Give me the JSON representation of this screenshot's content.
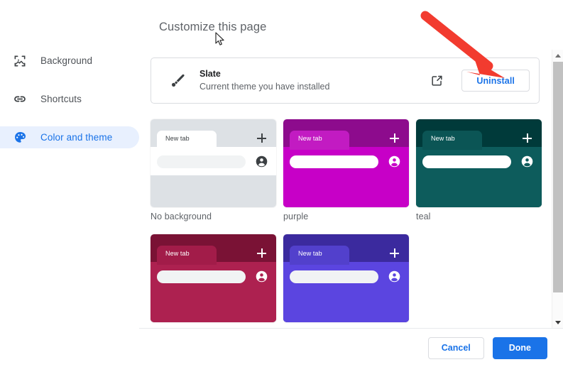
{
  "window": {
    "page_title": "Customize this page"
  },
  "sidebar": {
    "items": [
      {
        "label": "Background",
        "icon": "image-background-icon",
        "selected": false
      },
      {
        "label": "Shortcuts",
        "icon": "link-chain-icon",
        "selected": false
      },
      {
        "label": "Color and theme",
        "icon": "palette-icon",
        "selected": true
      }
    ]
  },
  "current_theme": {
    "icon": "paintbrush-icon",
    "name": "Slate",
    "description": "Current theme you have installed",
    "open_link_icon": "external-link-icon",
    "uninstall_label": "Uninstall"
  },
  "themes": {
    "rows": [
      [
        {
          "label": "No background",
          "frame_color": "#dde1e5",
          "body_color": "#ffffff",
          "lower_color": "#dde1e5",
          "tab_color": "#ffffff",
          "tab_text_color": "#3c4043",
          "plus_color": "#3c4043",
          "omnibox_color": "#f1f3f4",
          "avatar_color": "#3c4043",
          "tab_label": "New tab"
        },
        {
          "label": "purple",
          "frame_color": "#8d0b8d",
          "body_color": "#c700c7",
          "lower_color": "#c700c7",
          "tab_color": "#c21bc2",
          "tab_text_color": "#ffffff",
          "plus_color": "#ffffff",
          "omnibox_color": "#ffffff",
          "avatar_color": "#ffffff",
          "tab_label": "New tab"
        },
        {
          "label": "teal",
          "frame_color": "#003a3a",
          "body_color": "#0d5c5c",
          "lower_color": "#0d5c5c",
          "tab_color": "#0b5555",
          "tab_text_color": "#ffffff",
          "plus_color": "#ffffff",
          "omnibox_color": "#ffffff",
          "avatar_color": "#ffffff",
          "tab_label": "New tab"
        }
      ],
      [
        {
          "label": "",
          "frame_color": "#7a1235",
          "body_color": "#ad2150",
          "lower_color": "#ad2150",
          "tab_color": "#a21c49",
          "tab_text_color": "#ffffff",
          "plus_color": "#ffffff",
          "omnibox_color": "#f1f3f4",
          "avatar_color": "#ffffff",
          "tab_label": "New tab"
        },
        {
          "label": "",
          "frame_color": "#3b2a9e",
          "body_color": "#5b45e0",
          "lower_color": "#5b45e0",
          "tab_color": "#5240cc",
          "tab_text_color": "#ffffff",
          "plus_color": "#ffffff",
          "omnibox_color": "#f1f3f4",
          "avatar_color": "#ffffff",
          "tab_label": "New tab"
        }
      ]
    ]
  },
  "footer": {
    "cancel_label": "Cancel",
    "done_label": "Done"
  },
  "scrollbar": {
    "up_icon": "scroll-up-arrow-icon",
    "down_icon": "scroll-down-arrow-icon"
  },
  "annotation": {
    "arrow_color": "#f23b2f",
    "arrow_icon": "red-pointer-arrow"
  },
  "colors": {
    "accent_blue": "#1a73e8",
    "selected_pill": "#e8f0fe",
    "text_primary": "#202124",
    "text_secondary": "#5f6368",
    "border": "#dadce0"
  }
}
